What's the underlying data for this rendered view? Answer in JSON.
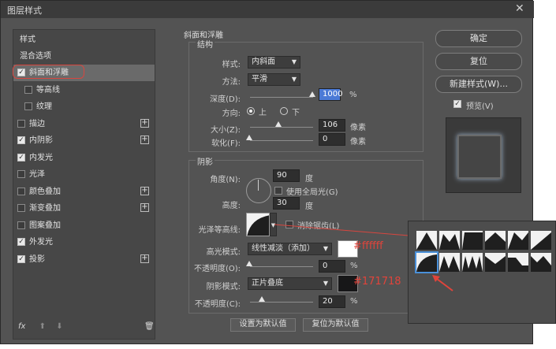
{
  "dialog": {
    "title": "图层样式"
  },
  "left_panel": {
    "header": "样式",
    "blend": "混合选项",
    "items": [
      {
        "label": "斜面和浮雕",
        "checked": true,
        "plus": false,
        "selected": true,
        "indent": 0
      },
      {
        "label": "等高线",
        "checked": false,
        "plus": false,
        "selected": false,
        "indent": 1
      },
      {
        "label": "纹理",
        "checked": false,
        "plus": false,
        "selected": false,
        "indent": 1
      },
      {
        "label": "描边",
        "checked": false,
        "plus": true,
        "selected": false,
        "indent": 0
      },
      {
        "label": "内阴影",
        "checked": true,
        "plus": true,
        "selected": false,
        "indent": 0
      },
      {
        "label": "内发光",
        "checked": true,
        "plus": false,
        "selected": false,
        "indent": 0
      },
      {
        "label": "光泽",
        "checked": false,
        "plus": false,
        "selected": false,
        "indent": 0
      },
      {
        "label": "颜色叠加",
        "checked": false,
        "plus": true,
        "selected": false,
        "indent": 0
      },
      {
        "label": "渐变叠加",
        "checked": false,
        "plus": true,
        "selected": false,
        "indent": 0
      },
      {
        "label": "图案叠加",
        "checked": false,
        "plus": false,
        "selected": false,
        "indent": 0
      },
      {
        "label": "外发光",
        "checked": true,
        "plus": false,
        "selected": false,
        "indent": 0
      },
      {
        "label": "投影",
        "checked": true,
        "plus": true,
        "selected": false,
        "indent": 0
      }
    ],
    "fx": "fx"
  },
  "bevel": {
    "section_title": "斜面和浮雕",
    "structure_title": "结构",
    "style_label": "样式:",
    "style_value": "内斜面",
    "technique_label": "方法:",
    "technique_value": "平滑",
    "depth_label": "深度(D):",
    "depth_value": "1000",
    "depth_unit": "%",
    "direction_label": "方向:",
    "dir_up": "上",
    "dir_down": "下",
    "size_label": "大小(Z):",
    "size_value": "106",
    "size_unit": "像素",
    "soften_label": "软化(F):",
    "soften_value": "0",
    "soften_unit": "像素",
    "shading_title": "阴影",
    "angle_label": "角度(N):",
    "angle_value": "90",
    "angle_unit": "度",
    "global_light": "使用全局光(G)",
    "altitude_label": "高度:",
    "altitude_value": "30",
    "altitude_unit": "度",
    "gloss_label": "光泽等高线:",
    "antialias": "消除锯齿(L)",
    "highlight_label": "高光模式:",
    "highlight_mode": "线性减淡（添加）",
    "highlight_color": "#ffffff",
    "opacity1_label": "不透明度(O):",
    "opacity1_value": "0",
    "opacity_unit": "%",
    "shadow_label": "阴影模式:",
    "shadow_mode": "正片叠底",
    "shadow_color": "#171718",
    "opacity2_label": "不透明度(C):",
    "opacity2_value": "20",
    "set_default": "设置为默认值",
    "reset_default": "复位为默认值"
  },
  "right": {
    "ok": "确定",
    "reset": "复位",
    "new_style": "新建样式(W)...",
    "preview": "预览(V)"
  },
  "annotations": {
    "highlight_hex": "#ffffff",
    "shadow_hex": "#171718"
  }
}
